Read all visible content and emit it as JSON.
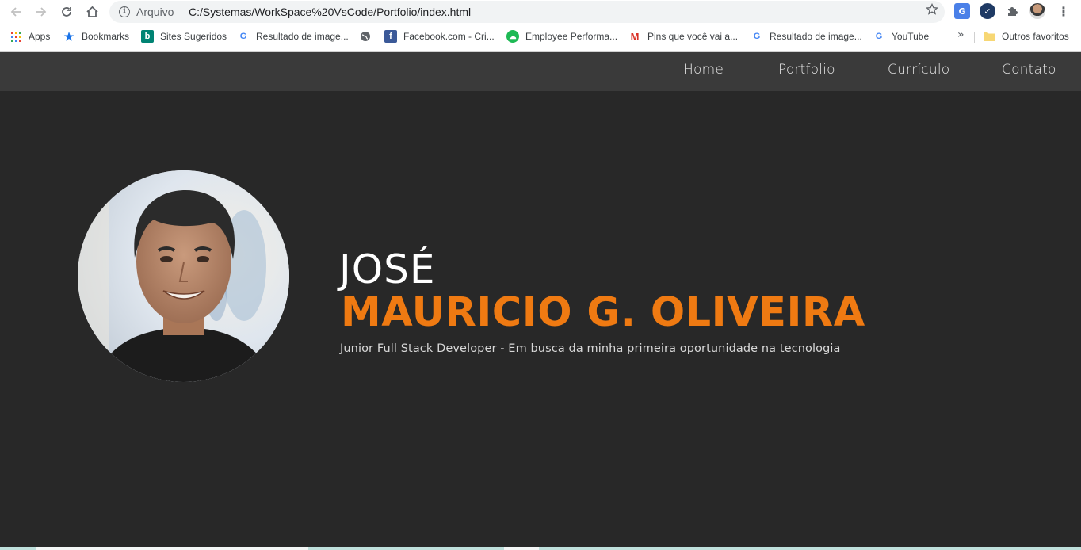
{
  "browser": {
    "scheme_label": "Arquivo",
    "url": "C:/Systemas/WorkSpace%20VsCode/Portfolio/index.html",
    "icons": {
      "back": "arrow-left-icon",
      "forward": "arrow-right-icon",
      "reload": "reload-icon",
      "home": "home-icon",
      "info": "info-icon",
      "star": "star-icon",
      "menu": "kebab-menu-icon"
    },
    "bookmarks": [
      {
        "label": "Apps",
        "icon": "apps-grid-icon"
      },
      {
        "label": "Bookmarks",
        "icon": "star-icon"
      },
      {
        "label": "Sites Sugeridos",
        "icon": "bing-icon"
      },
      {
        "label": "Resultado de image...",
        "icon": "google-icon"
      },
      {
        "label": "",
        "icon": "globe-icon"
      },
      {
        "label": "Facebook.com - Cri...",
        "icon": "facebook-icon"
      },
      {
        "label": "Employee Performa...",
        "icon": "cloud-icon"
      },
      {
        "label": "Pins que você vai a...",
        "icon": "gmail-icon"
      },
      {
        "label": "Resultado de image...",
        "icon": "google-icon"
      },
      {
        "label": "YouTube",
        "icon": "google-icon"
      }
    ],
    "overflow": "»",
    "other_bookmarks": "Outros favoritos"
  },
  "site": {
    "nav": [
      {
        "label": "Home"
      },
      {
        "label": "Portfolio"
      },
      {
        "label": "Currículo"
      },
      {
        "label": "Contato"
      }
    ],
    "hero": {
      "first_name": "JOSÉ",
      "last_name": "MAURICIO G. OLIVEIRA",
      "tagline": "Junior Full Stack Developer - Em busca da minha primeira oportunidade na tecnologia"
    }
  },
  "colors": {
    "accent": "#ef7a12",
    "nav_bg": "#3a3a3a",
    "page_bg": "#282828"
  }
}
